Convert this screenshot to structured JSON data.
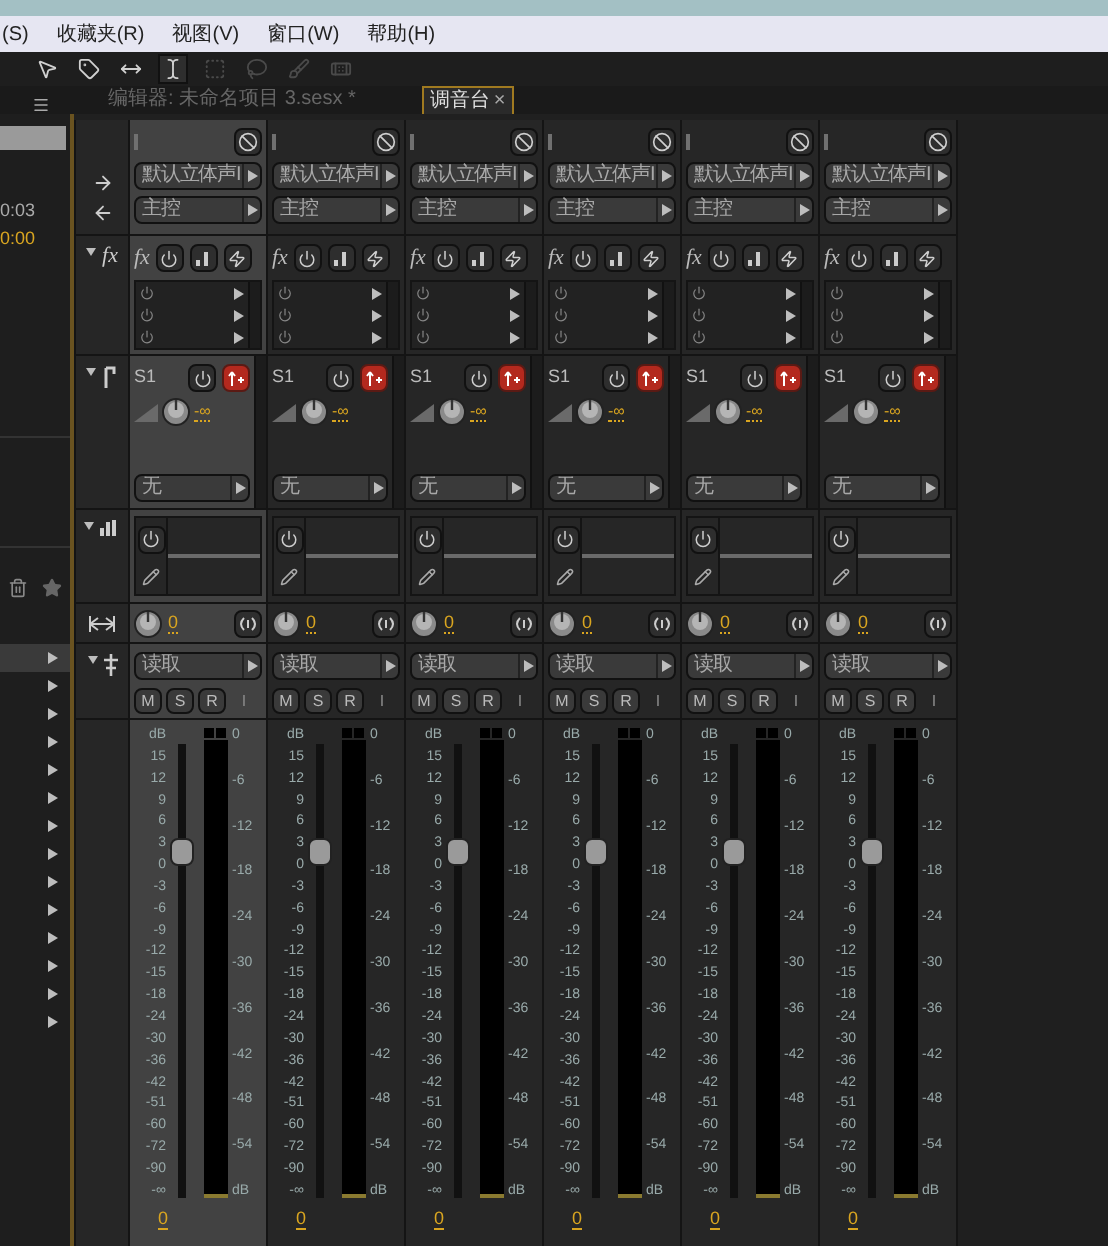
{
  "menu": [
    "(S)",
    "收藏夹(R)",
    "视图(V)",
    "窗口(W)",
    "帮助(H)"
  ],
  "toolbar": [
    {
      "kind": "move",
      "selected": false,
      "disabled": false
    },
    {
      "kind": "razor",
      "selected": false,
      "disabled": false
    },
    {
      "kind": "slip",
      "selected": false,
      "disabled": false
    },
    {
      "kind": "time",
      "selected": true,
      "disabled": false
    },
    {
      "kind": "marquee",
      "selected": false,
      "disabled": true
    },
    {
      "kind": "lasso",
      "selected": false,
      "disabled": true
    },
    {
      "kind": "brush",
      "selected": false,
      "disabled": true
    },
    {
      "kind": "heal",
      "selected": false,
      "disabled": true
    }
  ],
  "tabs": [
    {
      "label": "编辑器: 未命名项目 3.sesx *",
      "selected": false
    },
    {
      "label": "调音台",
      "selected": true,
      "close": "×"
    }
  ],
  "left_panel": {
    "duration": "0:03",
    "position": "0:00",
    "rows": [
      {
        "selected": true
      },
      {
        "selected": false
      },
      {
        "selected": false
      },
      {
        "selected": false
      },
      {
        "selected": false
      },
      {
        "selected": false
      },
      {
        "selected": false
      },
      {
        "selected": false
      },
      {
        "selected": false
      },
      {
        "selected": false
      },
      {
        "selected": false
      },
      {
        "selected": false
      },
      {
        "selected": false
      },
      {
        "selected": false
      }
    ]
  },
  "section_labels": {
    "fx": "fx"
  },
  "channels": [
    {
      "selected": true,
      "input": "默认立体声I",
      "output": "主控",
      "fx_label": "fx",
      "send": {
        "name": "S1",
        "volume": "-∞",
        "bus": "无"
      },
      "pan": "0",
      "automation": "读取",
      "buttons": [
        "M",
        "S",
        "R",
        "I"
      ],
      "fader_scale": [
        "dB",
        "15",
        "12",
        "9",
        "6",
        "3",
        "0",
        "-3",
        "-6",
        "-9",
        "-12",
        "-15",
        "-18",
        "-24",
        "-30",
        "-36",
        "-42",
        "-51",
        "-60",
        "-72",
        "-90",
        "-∞"
      ],
      "meter_scale": [
        "0",
        "-6",
        "-12",
        "-18",
        "-24",
        "-30",
        "-36",
        "-42",
        "-48",
        "-54",
        "dB"
      ],
      "level": 0.75,
      "gain": "0"
    },
    {
      "selected": false,
      "input": "默认立体声I",
      "output": "主控",
      "fx_label": "fx",
      "send": {
        "name": "S1",
        "volume": "-∞",
        "bus": "无"
      },
      "pan": "0",
      "automation": "读取",
      "buttons": [
        "M",
        "S",
        "R",
        "I"
      ],
      "fader_scale": [
        "dB",
        "15",
        "12",
        "9",
        "6",
        "3",
        "0",
        "-3",
        "-6",
        "-9",
        "-12",
        "-15",
        "-18",
        "-24",
        "-30",
        "-36",
        "-42",
        "-51",
        "-60",
        "-72",
        "-90",
        "-∞"
      ],
      "meter_scale": [
        "0",
        "-6",
        "-12",
        "-18",
        "-24",
        "-30",
        "-36",
        "-42",
        "-48",
        "-54",
        "dB"
      ],
      "level": 0.75,
      "gain": "0"
    },
    {
      "selected": false,
      "input": "默认立体声I",
      "output": "主控",
      "fx_label": "fx",
      "send": {
        "name": "S1",
        "volume": "-∞",
        "bus": "无"
      },
      "pan": "0",
      "automation": "读取",
      "buttons": [
        "M",
        "S",
        "R",
        "I"
      ],
      "fader_scale": [
        "dB",
        "15",
        "12",
        "9",
        "6",
        "3",
        "0",
        "-3",
        "-6",
        "-9",
        "-12",
        "-15",
        "-18",
        "-24",
        "-30",
        "-36",
        "-42",
        "-51",
        "-60",
        "-72",
        "-90",
        "-∞"
      ],
      "meter_scale": [
        "0",
        "-6",
        "-12",
        "-18",
        "-24",
        "-30",
        "-36",
        "-42",
        "-48",
        "-54",
        "dB"
      ],
      "level": 0.75,
      "gain": "0"
    },
    {
      "selected": false,
      "input": "默认立体声I",
      "output": "主控",
      "fx_label": "fx",
      "send": {
        "name": "S1",
        "volume": "-∞",
        "bus": "无"
      },
      "pan": "0",
      "automation": "读取",
      "buttons": [
        "M",
        "S",
        "R",
        "I"
      ],
      "fader_scale": [
        "dB",
        "15",
        "12",
        "9",
        "6",
        "3",
        "0",
        "-3",
        "-6",
        "-9",
        "-12",
        "-15",
        "-18",
        "-24",
        "-30",
        "-36",
        "-42",
        "-51",
        "-60",
        "-72",
        "-90",
        "-∞"
      ],
      "meter_scale": [
        "0",
        "-6",
        "-12",
        "-18",
        "-24",
        "-30",
        "-36",
        "-42",
        "-48",
        "-54",
        "dB"
      ],
      "level": 0.75,
      "gain": "0"
    },
    {
      "selected": false,
      "input": "默认立体声I",
      "output": "主控",
      "fx_label": "fx",
      "send": {
        "name": "S1",
        "volume": "-∞",
        "bus": "无"
      },
      "pan": "0",
      "automation": "读取",
      "buttons": [
        "M",
        "S",
        "R",
        "I"
      ],
      "fader_scale": [
        "dB",
        "15",
        "12",
        "9",
        "6",
        "3",
        "0",
        "-3",
        "-6",
        "-9",
        "-12",
        "-15",
        "-18",
        "-24",
        "-30",
        "-36",
        "-42",
        "-51",
        "-60",
        "-72",
        "-90",
        "-∞"
      ],
      "meter_scale": [
        "0",
        "-6",
        "-12",
        "-18",
        "-24",
        "-30",
        "-36",
        "-42",
        "-48",
        "-54",
        "dB"
      ],
      "level": 0.75,
      "gain": "0"
    },
    {
      "selected": false,
      "input": "默认立体声I",
      "output": "主控",
      "fx_label": "fx",
      "send": {
        "name": "S1",
        "volume": "-∞",
        "bus": "无"
      },
      "pan": "0",
      "automation": "读取",
      "buttons": [
        "M",
        "S",
        "R",
        "I"
      ],
      "fader_scale": [
        "dB",
        "15",
        "12",
        "9",
        "6",
        "3",
        "0",
        "-3",
        "-6",
        "-9",
        "-12",
        "-15",
        "-18",
        "-24",
        "-30",
        "-36",
        "-42",
        "-51",
        "-60",
        "-72",
        "-90",
        "-∞"
      ],
      "meter_scale": [
        "0",
        "-6",
        "-12",
        "-18",
        "-24",
        "-30",
        "-36",
        "-42",
        "-48",
        "-54",
        "dB"
      ],
      "level": 0.75,
      "gain": "0"
    }
  ]
}
